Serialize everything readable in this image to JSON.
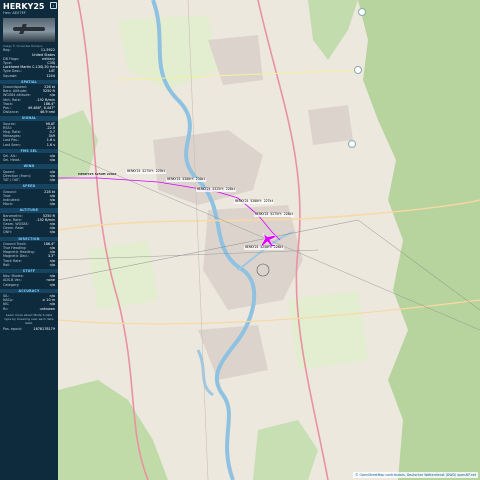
{
  "aircraft": {
    "callsign": "HERKY25",
    "hex_label": "Hex: AE07EF",
    "photo_caption": "Image © Vincentas Harrison",
    "collapse_icon": "chevron-left-icon",
    "info": [
      {
        "k": "Reg:",
        "v": "11-5922"
      },
      {
        "k": "",
        "v": "United States"
      },
      {
        "k": "DB Flags:",
        "v": "military"
      },
      {
        "k": "Type:",
        "v": "C30J"
      },
      {
        "k": "",
        "v": "Lockheed Martin C-130J-30 Hercules"
      },
      {
        "k": "Type Desc.:",
        "v": "L4T"
      },
      {
        "k": "Squawk:",
        "v": "1244"
      }
    ]
  },
  "sections": [
    {
      "title": "SPATIAL",
      "rows": [
        {
          "k": "Groundspeed:",
          "v": "228 kt"
        },
        {
          "k": "Baro. Altitude:",
          "v": "5250 ft"
        },
        {
          "k": "WGS84 altitude:",
          "v": "n/a"
        },
        {
          "k": "Vert. Rate:",
          "v": "-192 ft/min"
        },
        {
          "k": "Track:",
          "v": "186.4°"
        },
        {
          "k": "Pos.:",
          "v": "49.486°, 8.447°"
        },
        {
          "k": "Distance:",
          "v": "46.9 nmi"
        }
      ]
    },
    {
      "title": "SIGNAL",
      "rows": [
        {
          "k": "Source:",
          "v": "MLAT"
        },
        {
          "k": "RSSI:",
          "v": "-22.0"
        },
        {
          "k": "Msg. Rate:",
          "v": "0.7"
        },
        {
          "k": "Messages:",
          "v": "349"
        },
        {
          "k": "Last Pos.:",
          "v": "1.6 s"
        },
        {
          "k": "Last Seen:",
          "v": "1.6 s"
        }
      ]
    },
    {
      "title": "FMS SEL",
      "rows": [
        {
          "k": "Sel. Alt.:",
          "v": "n/a"
        },
        {
          "k": "Sel. Head.:",
          "v": "n/a"
        }
      ]
    },
    {
      "title": "WIND",
      "rows": [
        {
          "k": "Speed:",
          "v": "n/a"
        },
        {
          "k": "Direction (from):",
          "v": "n/a"
        },
        {
          "k": "TAT / OAT:",
          "v": "n/a"
        }
      ]
    },
    {
      "title": "SPEED",
      "rows": [
        {
          "k": "Ground:",
          "v": "228 kt"
        },
        {
          "k": "True:",
          "v": "n/a"
        },
        {
          "k": "Indicated:",
          "v": "n/a"
        },
        {
          "k": "Mach:",
          "v": "n/a"
        }
      ]
    },
    {
      "title": "ALTITUDE",
      "rows": [
        {
          "k": "Barometric:",
          "v": "5250 ft"
        },
        {
          "k": "Baro. Rate:",
          "v": "-192 ft/min"
        },
        {
          "k": "Geom. WGS84:",
          "v": "n/a"
        },
        {
          "k": "Geom. Rate:",
          "v": "n/a"
        },
        {
          "k": "QNH:",
          "v": "n/a"
        }
      ]
    },
    {
      "title": "DIRECTION",
      "rows": [
        {
          "k": "Ground Track:",
          "v": "186.4°"
        },
        {
          "k": "True Heading:",
          "v": "n/a"
        },
        {
          "k": "Magnetic Heading:",
          "v": "n/a"
        },
        {
          "k": "Magnetic Decl.:",
          "v": "3.3°"
        },
        {
          "k": "Track Rate:",
          "v": "n/a"
        },
        {
          "k": "Roll:",
          "v": "n/a"
        }
      ]
    },
    {
      "title": "STUFF",
      "rows": [
        {
          "k": "Nav. Modes:",
          "v": "n/a"
        },
        {
          "k": "ADS-B Ver.:",
          "v": "none"
        },
        {
          "k": "Category:",
          "v": "n/a"
        }
      ]
    },
    {
      "title": "ACCURACY",
      "rows": [
        {
          "k": "SIL:",
          "v": "n/a"
        },
        {
          "k": "NACp:",
          "v": "≥ 10 m"
        },
        {
          "k": "NIC",
          "v": "n/a"
        },
        {
          "k": "Rc:",
          "v": "unknown"
        }
      ]
    }
  ],
  "footer_note": "Learn more about Mode S data type by hovering over each data label.",
  "pos_epoch": {
    "k": "Pos. epoch:",
    "v": "1678178179"
  },
  "map": {
    "attribution": "© OpenStreetMap contributors, Deutscher Wetterdienst (DWD) openAIP.net",
    "track_labels": [
      "HERKY25 5250ft 228kt",
      "HERKY25 5275ft 229kt",
      "HERKY25 5300ft 230kt",
      "HERKY25 5325ft 228kt",
      "HERKY25 5300ft 227kt",
      "HERKY25 5275ft 228kt",
      "HERKY25 5250ft 228kt",
      "HERKY25 5250ft 228kt"
    ],
    "colors": {
      "track": "#d400ff",
      "sidebar": "#0e2a3d",
      "section": "#164461"
    },
    "plane_icon": "airplane-icon"
  }
}
